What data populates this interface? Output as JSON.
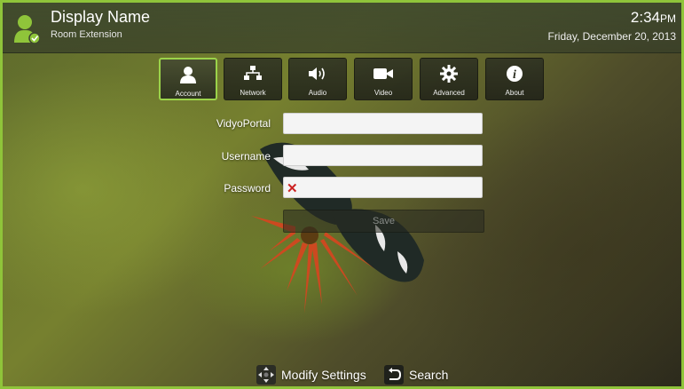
{
  "header": {
    "display_name": "Display Name",
    "subtitle": "Room Extension",
    "time": "2:34",
    "ampm": "PM",
    "date": "Friday, December 20, 2013"
  },
  "tabs": [
    {
      "label": "Account",
      "icon": "account-icon",
      "active": true
    },
    {
      "label": "Network",
      "icon": "network-icon",
      "active": false
    },
    {
      "label": "Audio",
      "icon": "audio-icon",
      "active": false
    },
    {
      "label": "Video",
      "icon": "video-icon",
      "active": false
    },
    {
      "label": "Advanced",
      "icon": "gear-icon",
      "active": false
    },
    {
      "label": "About",
      "icon": "info-icon",
      "active": false
    }
  ],
  "form": {
    "portal_label": "VidyoPortal",
    "portal_value": "",
    "username_label": "Username",
    "username_value": "",
    "password_label": "Password",
    "password_value": "",
    "password_status_icon": "invalid-x-icon",
    "save_label": "Save"
  },
  "footer": {
    "modify_label": "Modify Settings",
    "search_label": "Search"
  },
  "colors": {
    "accent": "#8fc43a",
    "error": "#cc2222"
  }
}
